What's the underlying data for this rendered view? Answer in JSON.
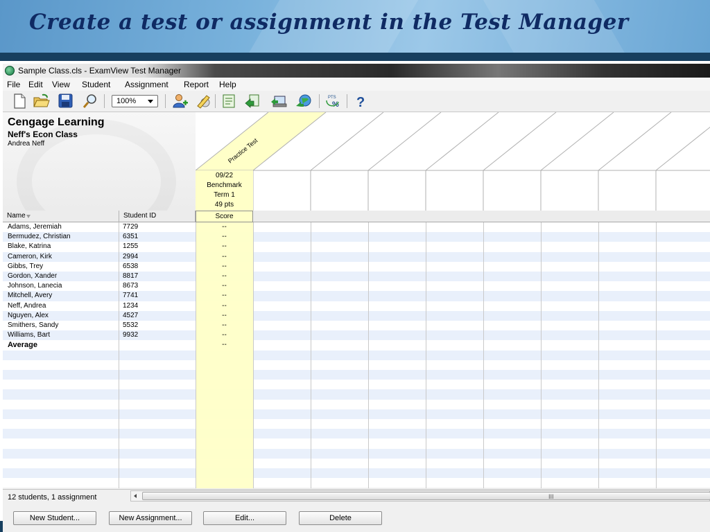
{
  "slide": {
    "title": "Create a test or assignment in the Test Manager"
  },
  "window": {
    "title": "Sample Class.cls - ExamView Test Manager"
  },
  "menu": [
    "File",
    "Edit",
    "View",
    "Student",
    "Assignment",
    "Report",
    "Help"
  ],
  "toolbar": {
    "zoom": "100%",
    "icons": [
      "new-file-icon",
      "open-folder-icon",
      "save-disk-icon",
      "find-magnifier-icon",
      "add-student-icon",
      "edit-pencil-icon",
      "assignment-report-icon",
      "import-scores-icon",
      "export-scores-icon",
      "online-globe-icon",
      "points-percent-icon",
      "help-question-icon"
    ],
    "pts_label": "PTS",
    "pct_label": "%",
    "help_glyph": "?"
  },
  "header": {
    "company": "Cengage Learning",
    "class_name": "Neff's Econ Class",
    "teacher": "Andrea Neff"
  },
  "assignment": {
    "name": "Practice Test",
    "date": "09/22",
    "category": "Benchmark",
    "term": "Term 1",
    "points": "49 pts"
  },
  "columns": {
    "name": "Name",
    "student_id": "Student ID",
    "score": "Score"
  },
  "students": [
    {
      "name": "Adams, Jeremiah",
      "id": "7729",
      "score": "--"
    },
    {
      "name": "Bermudez, Christian",
      "id": "6351",
      "score": "--"
    },
    {
      "name": "Blake, Katrina",
      "id": "1255",
      "score": "--"
    },
    {
      "name": "Cameron, Kirk",
      "id": "2994",
      "score": "--"
    },
    {
      "name": "Gibbs, Trey",
      "id": "6538",
      "score": "--"
    },
    {
      "name": "Gordon, Xander",
      "id": "8817",
      "score": "--"
    },
    {
      "name": "Johnson, Lanecia",
      "id": "8673",
      "score": "--"
    },
    {
      "name": "Mitchell, Avery",
      "id": "7741",
      "score": "--"
    },
    {
      "name": "Neff, Andrea",
      "id": "1234",
      "score": "--"
    },
    {
      "name": "Nguyen, Alex",
      "id": "4527",
      "score": "--"
    },
    {
      "name": "Smithers, Sandy",
      "id": "5532",
      "score": "--"
    },
    {
      "name": "Williams, Bart",
      "id": "9932",
      "score": "--"
    }
  ],
  "average": {
    "label": "Average",
    "score": "--"
  },
  "status": "12 students, 1 assignment",
  "scroll_grip": "III",
  "buttons": {
    "new_student": "New Student...",
    "new_assignment": "New Assignment...",
    "edit": "Edit...",
    "delete": "Delete"
  },
  "colors": {
    "title": "#0f2a63",
    "header_bar": "#173f5f",
    "assignment_highlight": "#ffffc8",
    "row_stripe": "#e9f0fb"
  }
}
